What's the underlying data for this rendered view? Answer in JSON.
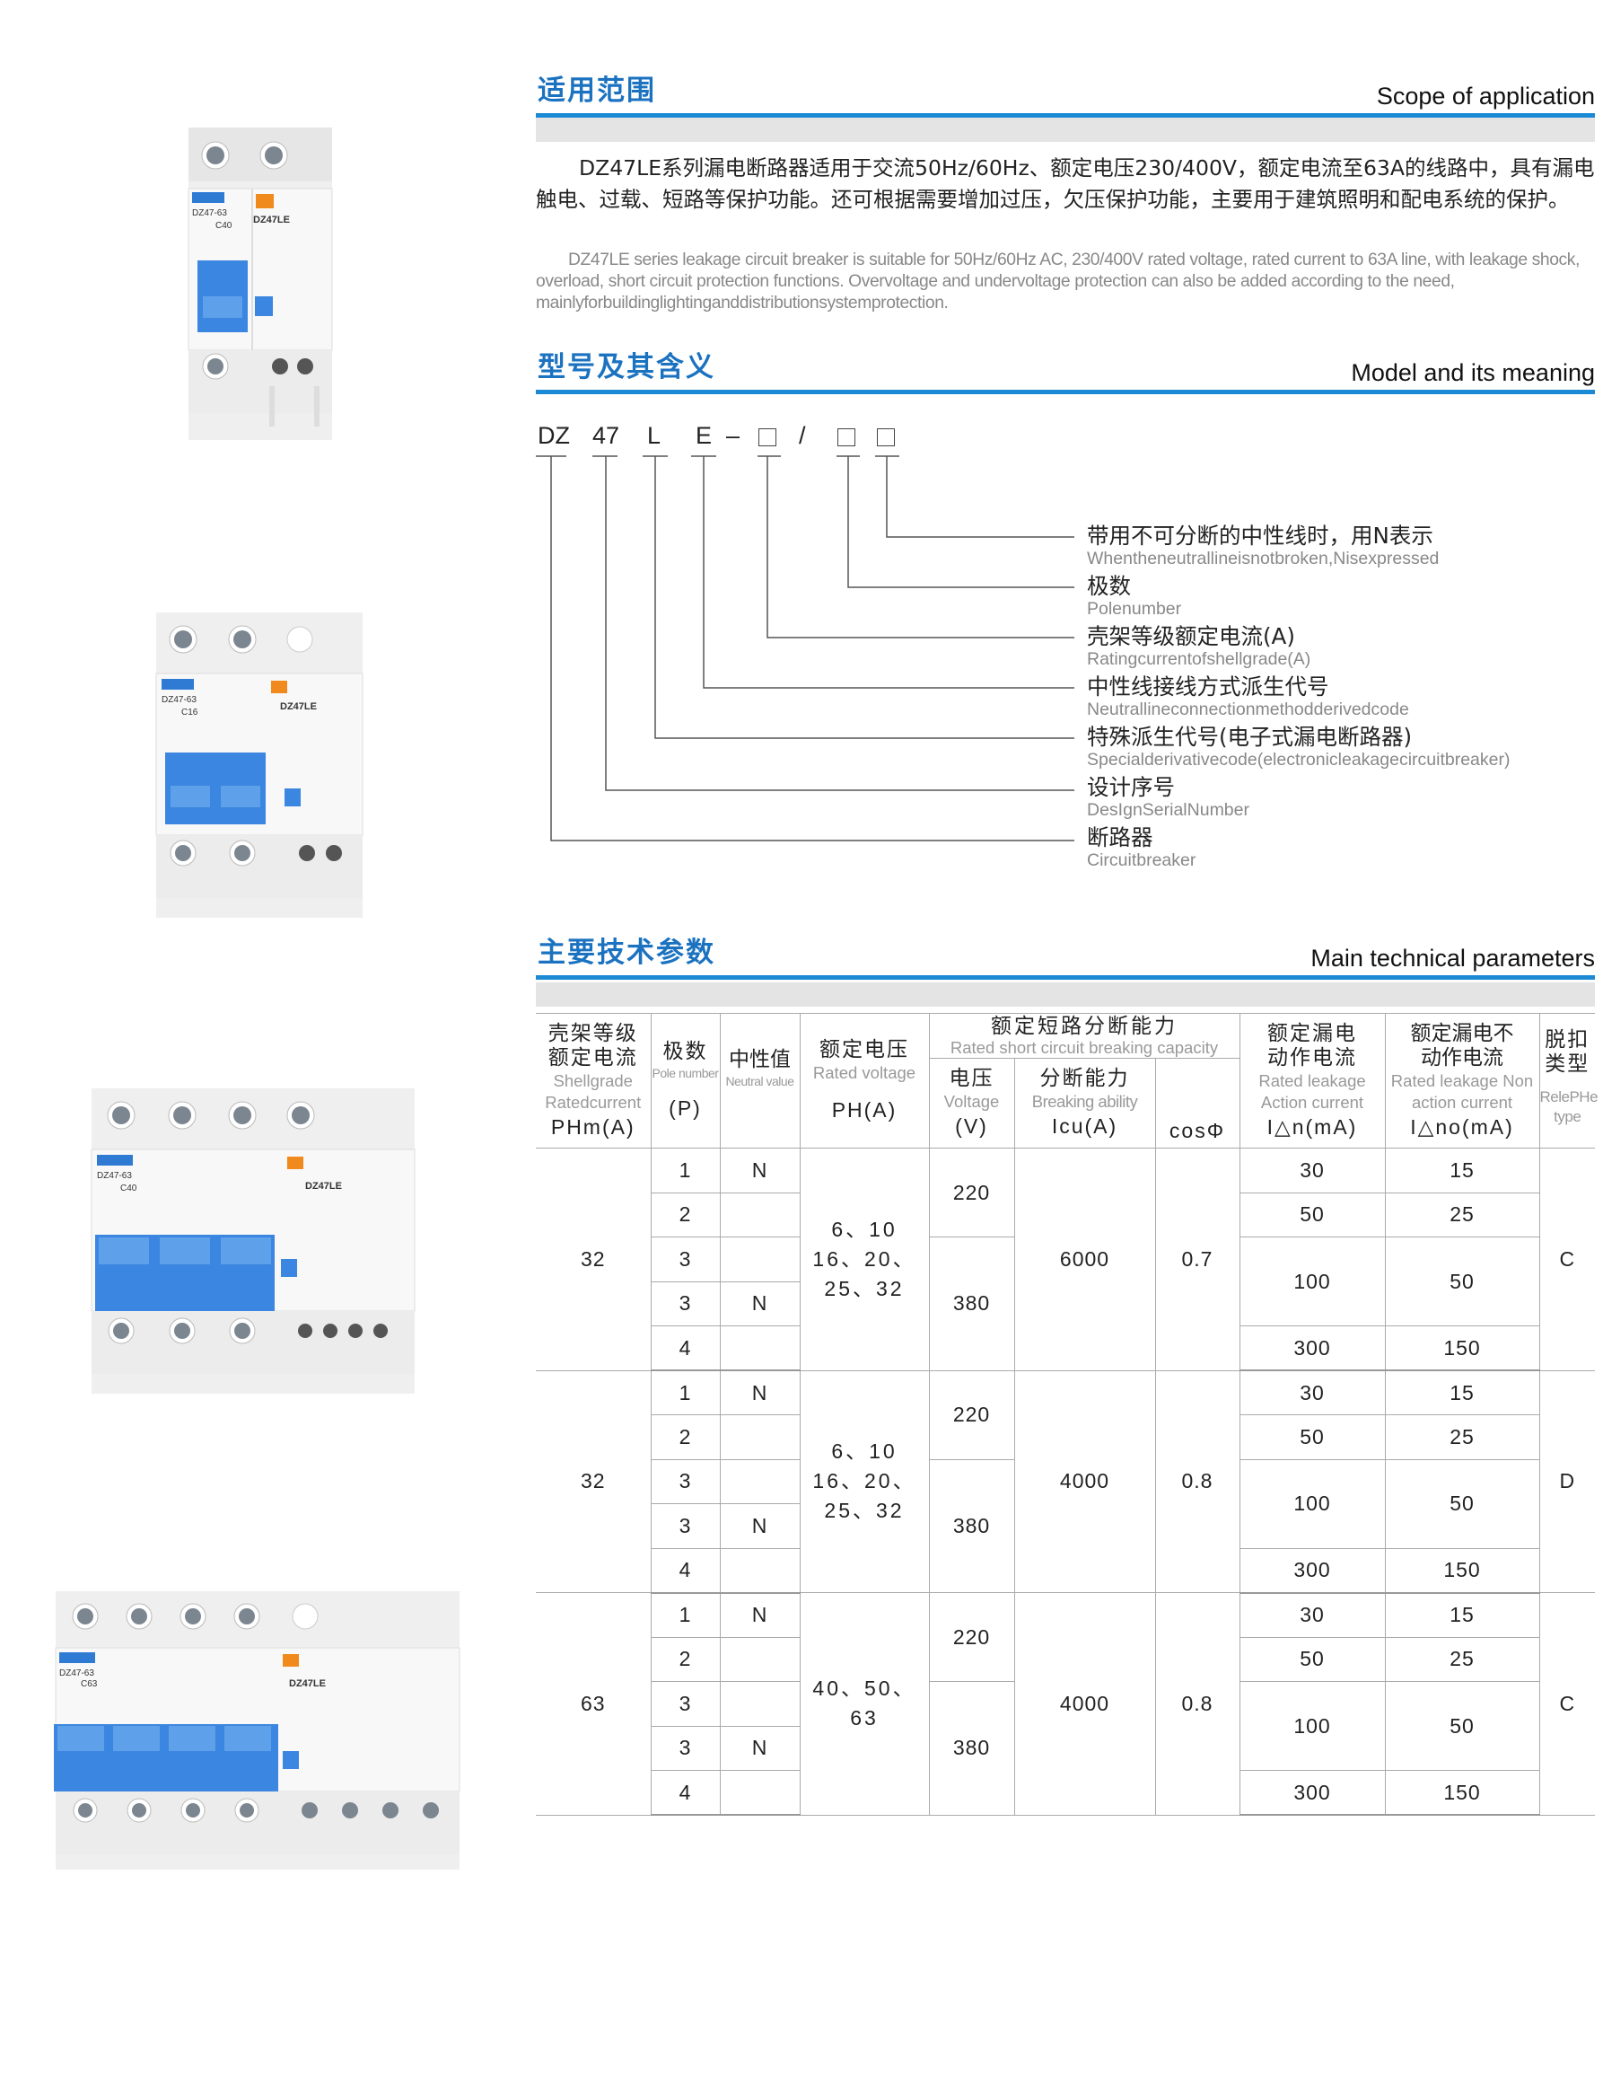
{
  "scope": {
    "title_cn": "适用范围",
    "title_en": "Scope of application",
    "text_cn": "DZ47LE系列漏电断路器适用于交流50Hz/60Hz、额定电压230/400V，额定电流至63A的线路中，具有漏电触电、过载、短路等保护功能。还可根据需要增加过压，欠压保护功能，主要用于建筑照明和配电系统的保护。",
    "text_en": "DZ47LE series leakage circuit breaker is suitable for 50Hz/60Hz AC, 230/400V rated voltage, rated current to 63A line, with leakage shock, overload, short circuit protection functions. Overvoltage and undervoltage protection can also be added according to the need, mainlyforbuildinglightinganddistributionsystemprotection."
  },
  "model": {
    "title_cn": "型号及其含义",
    "title_en": "Model and its meaning",
    "code": [
      "DZ",
      "47",
      "L",
      "E",
      "–",
      "/"
    ],
    "items": [
      {
        "cn": "带用不可分断的中性线时，用N表示",
        "en": "Whentheneutrallineisnotbroken,Nisexpressed"
      },
      {
        "cn": "极数",
        "en": "Polenumber"
      },
      {
        "cn": "壳架等级额定电流(A)",
        "en": "Ratingcurrentofshellgrade(A)"
      },
      {
        "cn": "中性线接线方式派生代号",
        "en": "Neutrallineconnectionmethodderivedcode"
      },
      {
        "cn": "特殊派生代号(电子式漏电断路器)",
        "en": "Specialderivativecode(electronicleakagecircuitbreaker)"
      },
      {
        "cn": "设计序号",
        "en": "DesIgnSerialNumber"
      },
      {
        "cn": "断路器",
        "en": "Circuitbreaker"
      }
    ]
  },
  "params": {
    "title_cn": "主要技术参数",
    "title_en": "Main technical parameters",
    "headers": {
      "shell_cn": "壳架等级额定电流",
      "shell_en1": "Shellgrade",
      "shell_en2": "Ratedcurrent",
      "shell_sym": "PHm(A)",
      "pole_cn": "极数",
      "pole_en": "Pole number",
      "pole_sym": "(P)",
      "neutral_cn": "中性值",
      "neutral_en": "Neutral value",
      "volt_cn": "额定电压",
      "volt_en": "Rated voltage",
      "volt_sym": "PH(A)",
      "break_cn": "额定短路分断能力",
      "break_en": "Rated short circuit breaking capacity",
      "bv_cn": "电压",
      "bv_en": "Voltage",
      "bv_sym": "(V)",
      "bc_cn": "分断能力",
      "bc_en": "Breaking ability",
      "bc_sym": "Icu(A)",
      "cos": "cosΦ",
      "leak_cn": "额定漏电动作电流",
      "leak_en": "Rated leakage Action current",
      "leak_sym": "I△n(mA)",
      "nonleak_cn": "额定漏电不动作电流",
      "nonleak_en": "Rated leakage Non action current",
      "nonleak_sym": "I△no(mA)",
      "trip_cn": "脱扣类型",
      "trip_en": "RelePHe type"
    },
    "groups": [
      {
        "shell": "32",
        "voltage": "6、10\n16、20、\n25、32",
        "v1": "220",
        "v2": "380",
        "icu": "6000",
        "cos": "0.7",
        "trip": "C",
        "poles": [
          {
            "p": "1",
            "n": "N"
          },
          {
            "p": "2",
            "n": ""
          },
          {
            "p": "3",
            "n": ""
          },
          {
            "p": "3",
            "n": "N"
          },
          {
            "p": "4",
            "n": ""
          }
        ],
        "leak": [
          [
            "30",
            "15"
          ],
          [
            "50",
            "25"
          ],
          [
            "100",
            "50"
          ],
          [
            "300",
            "150"
          ]
        ]
      },
      {
        "shell": "32",
        "voltage": "6、10\n16、20、\n25、32",
        "v1": "220",
        "v2": "380",
        "icu": "4000",
        "cos": "0.8",
        "trip": "D",
        "poles": [
          {
            "p": "1",
            "n": "N"
          },
          {
            "p": "2",
            "n": ""
          },
          {
            "p": "3",
            "n": ""
          },
          {
            "p": "3",
            "n": "N"
          },
          {
            "p": "4",
            "n": ""
          }
        ],
        "leak": [
          [
            "30",
            "15"
          ],
          [
            "50",
            "25"
          ],
          [
            "100",
            "50"
          ],
          [
            "300",
            "150"
          ]
        ]
      },
      {
        "shell": "63",
        "voltage": "40、50、\n63",
        "v1": "220",
        "v2": "380",
        "icu": "4000",
        "cos": "0.8",
        "trip": "C",
        "poles": [
          {
            "p": "1",
            "n": "N"
          },
          {
            "p": "2",
            "n": ""
          },
          {
            "p": "3",
            "n": ""
          },
          {
            "p": "3",
            "n": "N"
          },
          {
            "p": "4",
            "n": ""
          }
        ],
        "leak": [
          [
            "30",
            "15"
          ],
          [
            "50",
            "25"
          ],
          [
            "100",
            "50"
          ],
          [
            "300",
            "150"
          ]
        ]
      }
    ]
  },
  "products": [
    {
      "model": "DZ47-63",
      "rating": "C40",
      "label": "DZ47LE",
      "poles": 1
    },
    {
      "model": "DZ47-63",
      "rating": "C16",
      "label": "DZ47LE",
      "poles": 2
    },
    {
      "model": "DZ47-63",
      "rating": "C40",
      "label": "DZ47LE",
      "poles": 3
    },
    {
      "model": "DZ47-63",
      "rating": "C63",
      "label": "DZ47LE",
      "poles": 4
    }
  ]
}
